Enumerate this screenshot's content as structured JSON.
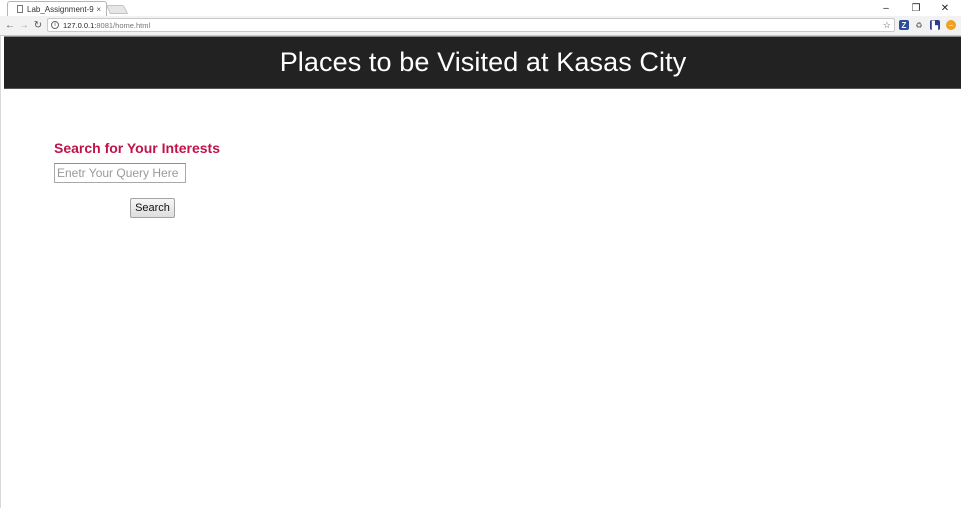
{
  "browser": {
    "tab_title": "Lab_Assignment-9",
    "tab_close": "×",
    "url_host": "127.0.0.1:",
    "url_rest": "8081/home.html",
    "window_controls": {
      "minimize": "–",
      "restore": "❐",
      "close": "✕"
    },
    "nav": {
      "back": "←",
      "forward": "→",
      "reload": "↻"
    },
    "star": "☆",
    "extensions": [
      {
        "name": "zotero-icon",
        "glyph": "Z"
      },
      {
        "name": "recycle-icon",
        "glyph": "♻"
      },
      {
        "name": "docs-icon",
        "glyph": "▙"
      },
      {
        "name": "no-entry-icon",
        "glyph": "−"
      }
    ]
  },
  "page": {
    "banner_title": "Places to be Visited at Kasas City",
    "search_heading": "Search for Your Interests",
    "query_placeholder": "Enetr Your Query Here",
    "query_value": "",
    "search_button_label": "Search"
  },
  "colors": {
    "banner_bg": "#222222",
    "heading_accent": "#c0134a"
  }
}
